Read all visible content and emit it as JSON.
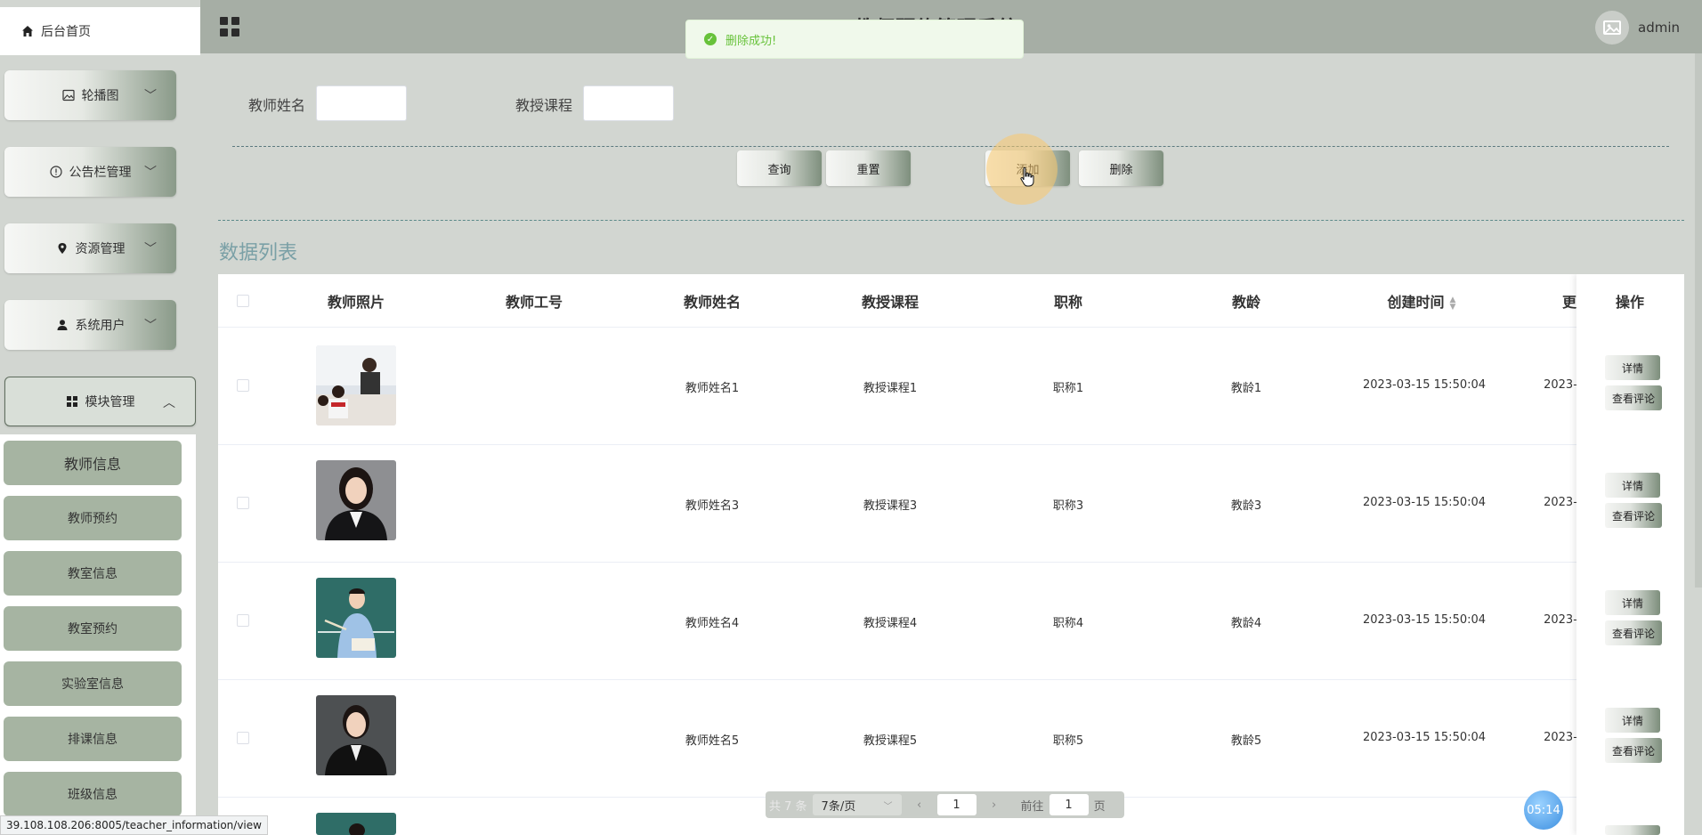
{
  "app": {
    "title": "教师预约管理系统",
    "user": "admin"
  },
  "toast": {
    "text": "删除成功!"
  },
  "sidebar": {
    "home": "后台首页",
    "menus": [
      {
        "label": "轮播图",
        "icon": "image-icon"
      },
      {
        "label": "公告栏管理",
        "icon": "info-circle-icon"
      },
      {
        "label": "资源管理",
        "icon": "location-pin-icon"
      },
      {
        "label": "系统用户",
        "icon": "user-icon"
      },
      {
        "label": "模块管理",
        "icon": "grid-icon"
      }
    ],
    "submenu": [
      "教师信息",
      "教师预约",
      "教室信息",
      "教室预约",
      "实验室信息",
      "排课信息",
      "班级信息"
    ]
  },
  "search": {
    "teacher_name_label": "教师姓名",
    "course_label": "教授课程",
    "buttons": {
      "query": "查询",
      "reset": "重置",
      "add": "添加",
      "delete": "删除"
    }
  },
  "list": {
    "title": "数据列表",
    "columns": [
      "教师照片",
      "教师工号",
      "教师姓名",
      "教授课程",
      "职称",
      "教龄",
      "创建时间",
      "更",
      "操作"
    ],
    "rows": [
      {
        "name": "教师姓名1",
        "course": "教授课程1",
        "title": "职称1",
        "years": "教龄1",
        "created": "2023-03-15 15:50:04",
        "updated": "2023-"
      },
      {
        "name": "教师姓名3",
        "course": "教授课程3",
        "title": "职称3",
        "years": "教龄3",
        "created": "2023-03-15 15:50:04",
        "updated": "2023-"
      },
      {
        "name": "教师姓名4",
        "course": "教授课程4",
        "title": "职称4",
        "years": "教龄4",
        "created": "2023-03-15 15:50:04",
        "updated": "2023-"
      },
      {
        "name": "教师姓名5",
        "course": "教授课程5",
        "title": "职称5",
        "years": "教龄5",
        "created": "2023-03-15 15:50:04",
        "updated": "2023-"
      }
    ],
    "row_actions": {
      "detail": "详情",
      "comments": "查看评论"
    }
  },
  "pagination": {
    "total": "共 7 条",
    "page_size": "7条/页",
    "current": "1",
    "goto_prefix": "前往",
    "goto_value": "1",
    "goto_suffix": "页"
  },
  "timer": "05:14",
  "status_url": "39.108.108.206:8005/teacher_information/view",
  "colors": {
    "topbar": "#a6aea5",
    "submenu_item": "#a6b4a2",
    "toast": "#67c23a",
    "list_title": "#7aa0a6"
  }
}
